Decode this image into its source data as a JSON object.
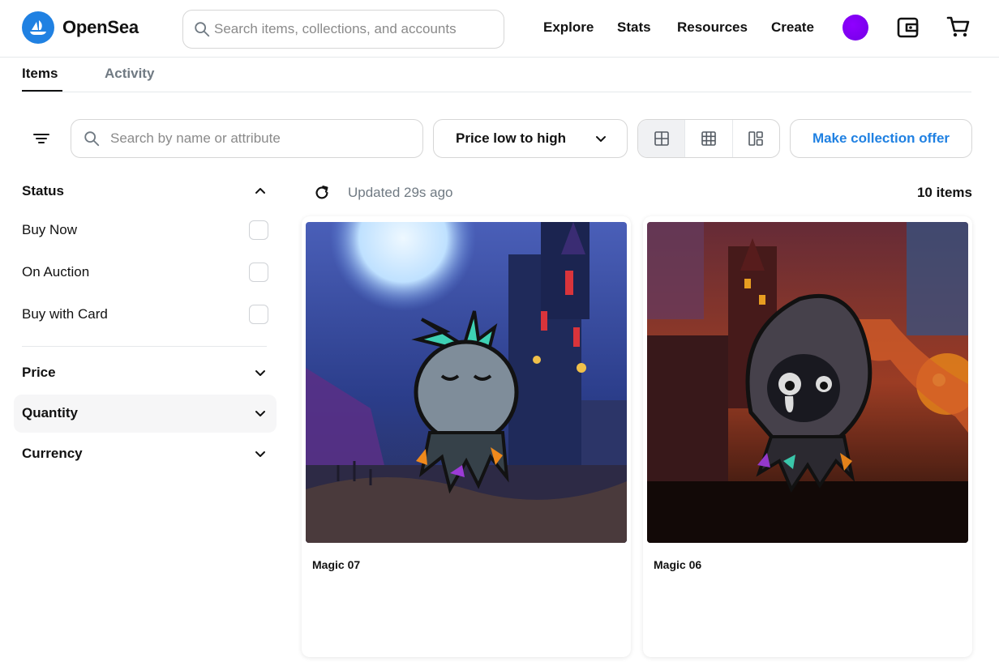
{
  "brand": {
    "name": "OpenSea",
    "accent": "#2081e2"
  },
  "header": {
    "search_placeholder": "Search items, collections, and accounts",
    "nav": {
      "explore": "Explore",
      "stats": "Stats",
      "resources": "Resources",
      "create": "Create"
    },
    "icons": [
      "wallet-icon",
      "cart-icon"
    ],
    "avatar_color": "#8200f0"
  },
  "tabs": {
    "items": "Items",
    "activity": "Activity",
    "active": "Items"
  },
  "toolbar": {
    "search_placeholder": "Search by name or attribute",
    "sort_label": "Price low to high",
    "view_modes": [
      "large-grid",
      "small-grid",
      "mosaic"
    ],
    "active_view": "large-grid",
    "offer_label": "Make collection offer"
  },
  "filters": {
    "status": {
      "title": "Status",
      "options": {
        "buy_now": "Buy Now",
        "on_auction": "On Auction",
        "buy_with_card": "Buy with Card"
      },
      "expanded": true
    },
    "price": "Price",
    "quantity": "Quantity",
    "currency": "Currency"
  },
  "results": {
    "updated": "Updated 29s ago",
    "count": "10 items",
    "cards": [
      {
        "name": "Magic 07"
      },
      {
        "name": "Magic 06"
      }
    ]
  }
}
